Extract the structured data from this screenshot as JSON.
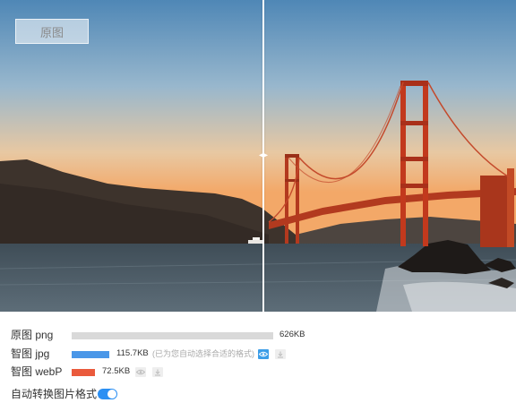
{
  "viewer": {
    "original_badge": "原图"
  },
  "rows": [
    {
      "label": "原图 png",
      "size": "626KB",
      "bar_fraction": 1.0,
      "color": "#d9d9d9"
    },
    {
      "label": "智图 jpg",
      "size": "115.7KB",
      "bar_fraction": 0.185,
      "color": "#4a97e8",
      "note": "(已为您自动选择合适的格式)"
    },
    {
      "label": "智图 webP",
      "size": "72.5KB",
      "bar_fraction": 0.116,
      "color": "#ea5a3c"
    }
  ],
  "icons": {
    "preview": "eye-icon",
    "download": "download-icon"
  },
  "auto_convert": {
    "label": "自动转换图片格式：",
    "enabled": true
  },
  "colors": {
    "accent": "#2b8ff3",
    "active_preview": "#3b9de8",
    "inactive_icon": "#dddddd"
  }
}
